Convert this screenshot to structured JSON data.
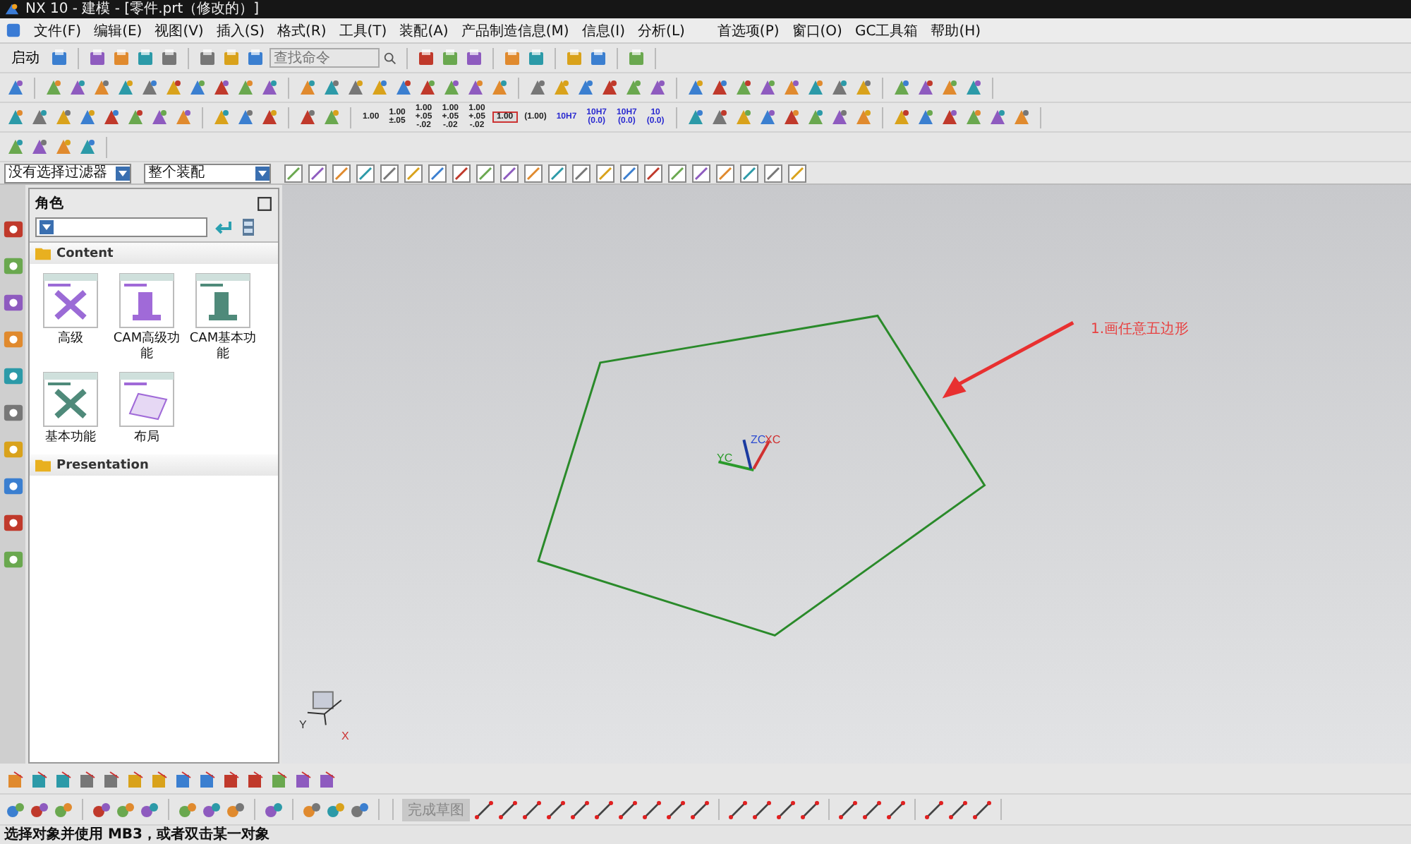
{
  "window": {
    "title": "NX 10 - 建模 - [零件.prt（修改的）]"
  },
  "menu": [
    "文件(F)",
    "编辑(E)",
    "视图(V)",
    "插入(S)",
    "格式(R)",
    "工具(T)",
    "装配(A)",
    "产品制造信息(M)",
    "信息(I)",
    "分析(L)",
    "首选项(P)",
    "窗口(O)",
    "GC工具箱",
    "帮助(H)"
  ],
  "toolbar": {
    "start_label": "启动",
    "search": {
      "placeholder": "查找命令"
    },
    "dimension_styles": [
      {
        "kind": "plain",
        "lines": [
          "1.00"
        ]
      },
      {
        "kind": "plain",
        "lines": [
          "1.00",
          "±.05"
        ]
      },
      {
        "kind": "plain",
        "lines": [
          "1.00",
          "+.05",
          "-.02"
        ]
      },
      {
        "kind": "plain",
        "lines": [
          "1.00",
          "+.05",
          "-.02"
        ]
      },
      {
        "kind": "plain",
        "lines": [
          "1.00",
          "+.05",
          "-.02"
        ]
      },
      {
        "kind": "boxed",
        "lines": [
          "1.00"
        ]
      },
      {
        "kind": "plain",
        "lines": [
          "(1.00)"
        ]
      },
      {
        "kind": "fit",
        "lines": [
          "10H7"
        ]
      },
      {
        "kind": "fit",
        "lines": [
          "10H7",
          "(0.0)"
        ]
      },
      {
        "kind": "fit",
        "lines": [
          "10H7",
          "(0.0)"
        ]
      },
      {
        "kind": "fit",
        "lines": [
          "10",
          "(0.0)"
        ]
      }
    ]
  },
  "selection_bar": {
    "filter": "没有选择过滤器",
    "scope": "整个装配"
  },
  "role_panel": {
    "title": "角色",
    "sections": [
      {
        "title": "Content",
        "items": [
          {
            "label": "高级",
            "kind": "tools"
          },
          {
            "label": "CAM高级功能",
            "kind": "machine"
          },
          {
            "label": "CAM基本功能",
            "kind": "machine-basic"
          },
          {
            "label": "基本功能",
            "kind": "tools-basic"
          },
          {
            "label": "布局",
            "kind": "layout"
          }
        ]
      },
      {
        "title": "Presentation"
      }
    ]
  },
  "viewport": {
    "annotation": "1.画任意五边形",
    "triad": [
      "YC",
      "ZC",
      "XC"
    ],
    "small_triad": [
      "Y",
      "X"
    ]
  },
  "bottom_toolbar": {
    "finish_sketch": "完成草图"
  },
  "status_bar": "选择对象并使用 MB3，或者双击某一对象"
}
